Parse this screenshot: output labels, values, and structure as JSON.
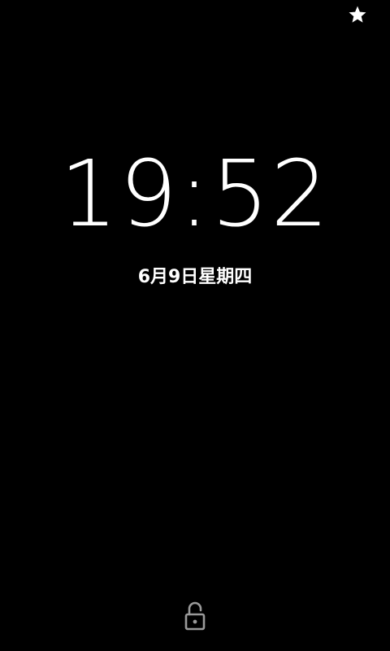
{
  "status_bar": {
    "star_icon": "star-icon"
  },
  "lockscreen": {
    "time": "19:52",
    "date": "6月9日星期四",
    "unlock_icon": "unlock-icon"
  },
  "colors": {
    "background": "#000000",
    "text": "#ffffff",
    "unlock_icon": "#9a9a9a"
  }
}
